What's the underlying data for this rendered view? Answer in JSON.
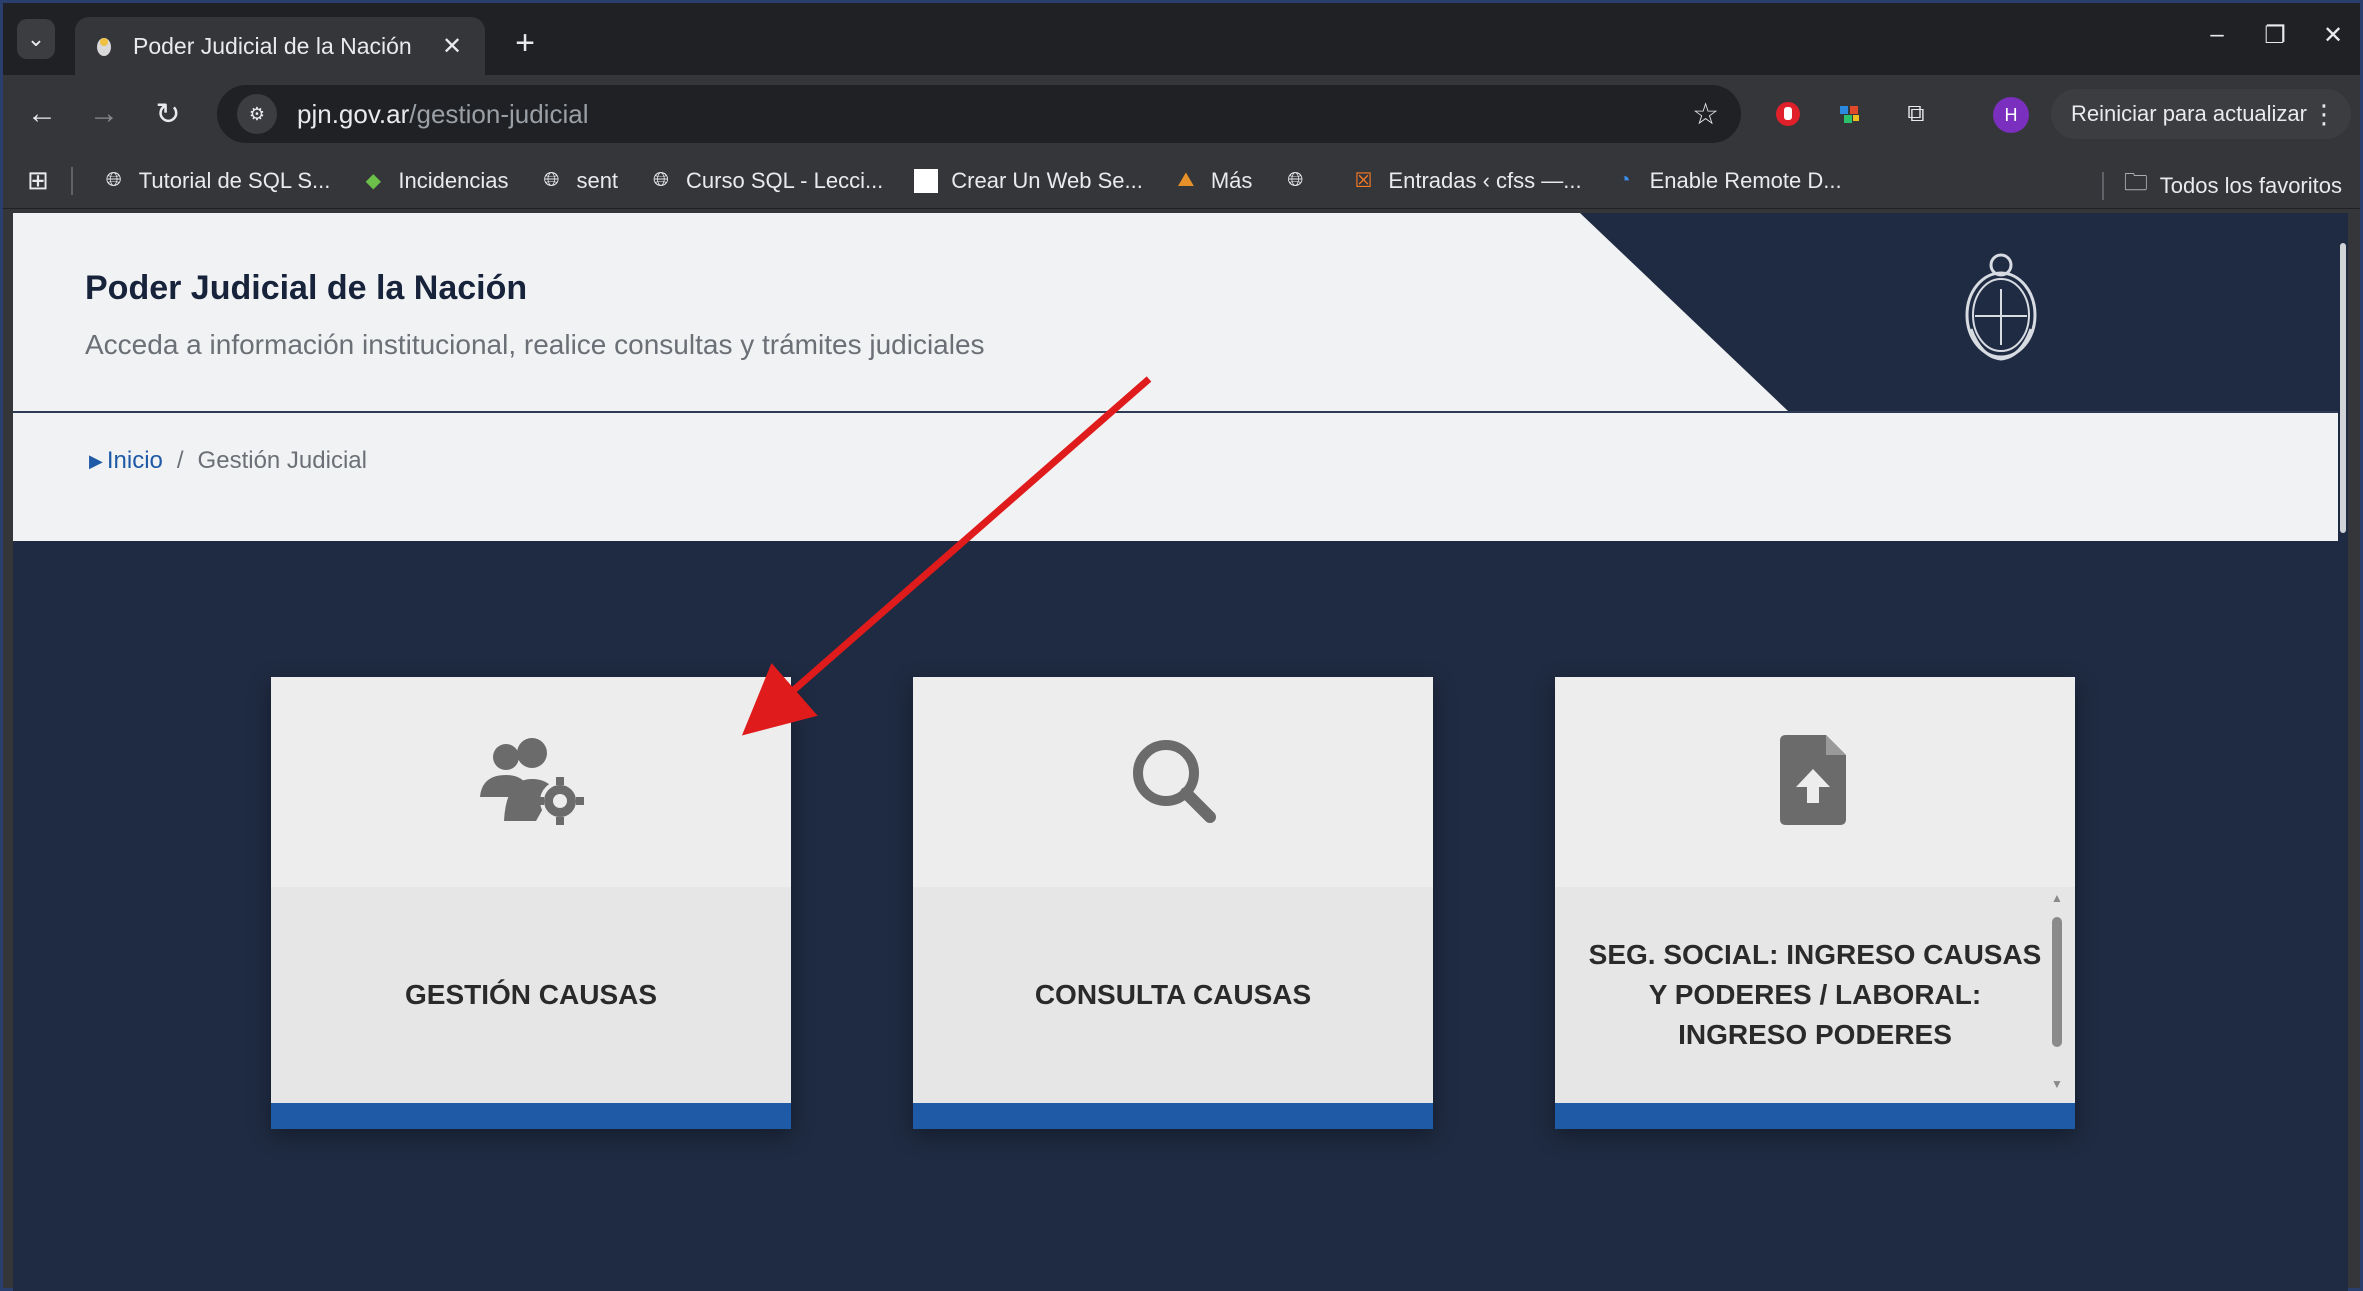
{
  "browser": {
    "tab": {
      "title": "Poder Judicial de la Nación"
    },
    "new_tab_label": "+",
    "omnibox": {
      "host": "pjn.gov.ar",
      "path": "/gestion-judicial"
    },
    "profile_initial": "H",
    "restart_label": "Reiniciar para actualizar",
    "bookmarks": [
      {
        "label": "Tutorial de SQL S...",
        "icon": "globe-icon"
      },
      {
        "label": "Incidencias",
        "icon": "bookmark-favicon"
      },
      {
        "label": "sent",
        "icon": "globe-icon"
      },
      {
        "label": "Curso SQL - Lecci...",
        "icon": "globe-icon"
      },
      {
        "label": "Crear Un Web Se...",
        "icon": "blank-page-icon"
      },
      {
        "label": "Más",
        "icon": "bookmark-favicon"
      },
      {
        "label": "",
        "icon": "globe-icon"
      },
      {
        "label": "Entradas ‹ cfss —...",
        "icon": "xampp-icon"
      },
      {
        "label": "Enable Remote D...",
        "icon": "remote-icon"
      }
    ],
    "all_bookmarks_label": "Todos los favoritos"
  },
  "site": {
    "title": "Poder Judicial de la Nación",
    "subtitle": "Acceda a información institucional, realice consultas y trámites judiciales",
    "breadcrumb": {
      "home": "Inicio",
      "separator": "/",
      "current": "Gestión Judicial"
    }
  },
  "cards": [
    {
      "label": "GESTIÓN CAUSAS",
      "icon": "users-gear-icon"
    },
    {
      "label": "CONSULTA CAUSAS",
      "icon": "search-icon"
    },
    {
      "label": "SEG. SOCIAL: INGRESO CAUSAS Y PODERES / LABORAL: INGRESO PODERES",
      "icon": "file-upload-icon"
    }
  ],
  "colors": {
    "accent": "#1f5aa6",
    "navy": "#1f2b42",
    "annotation_arrow": "#e01b1b"
  }
}
